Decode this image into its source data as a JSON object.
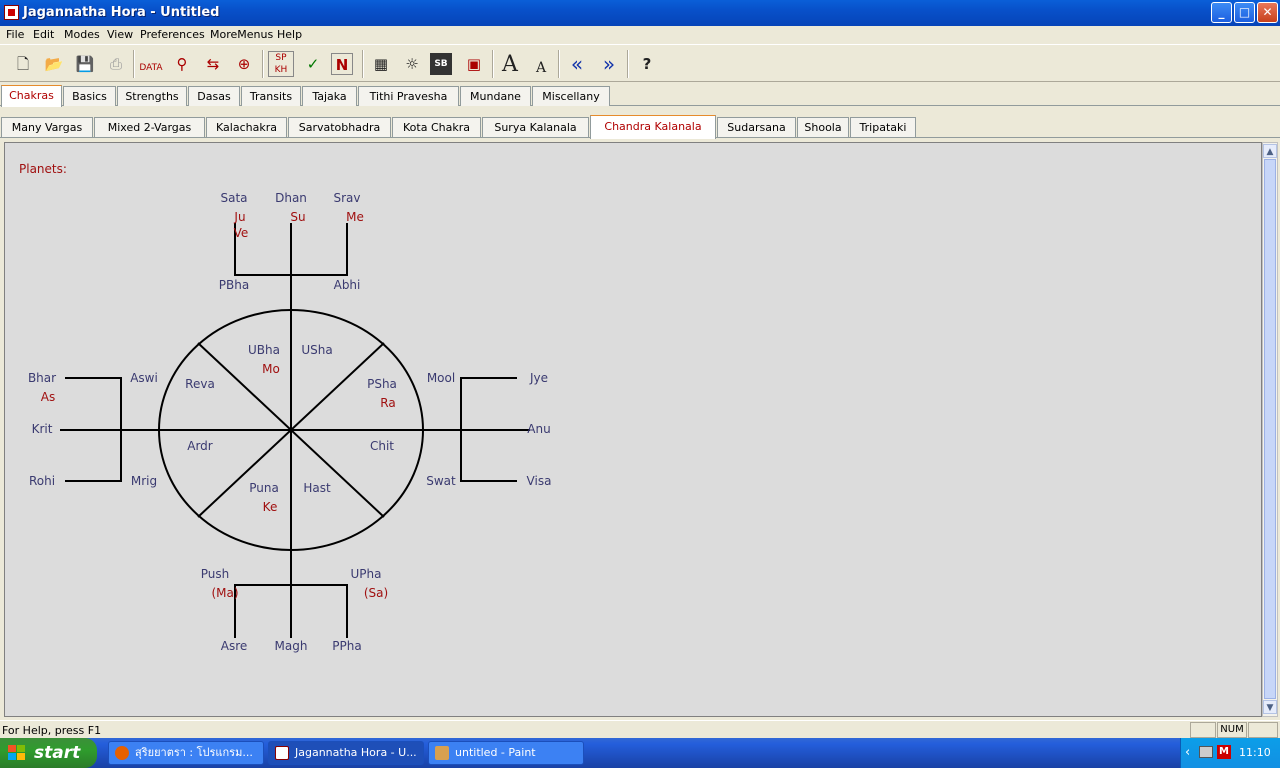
{
  "window": {
    "title": "Jagannatha Hora - Untitled"
  },
  "menu": [
    "File",
    "Edit",
    "Modes",
    "View",
    "Preferences",
    "MoreMenus",
    "Help"
  ],
  "toolbar": {
    "font_large": "A",
    "font_small": "A",
    "help": "?",
    "sp_kh": "SP KH",
    "n_btn": "N",
    "sb_btn": "SB"
  },
  "tabs_main": [
    "Chakras",
    "Basics",
    "Strengths",
    "Dasas",
    "Transits",
    "Tajaka",
    "Tithi Pravesha",
    "Mundane",
    "Miscellany"
  ],
  "tabs_sub": [
    "Many Vargas",
    "Mixed 2-Vargas",
    "Kalachakra",
    "Sarvatobhadra",
    "Kota Chakra",
    "Surya Kalanala",
    "Chandra Kalanala",
    "Sudarsana",
    "Shoola",
    "Tripataki"
  ],
  "chakra": {
    "heading": "Planets:",
    "nakshatras": {
      "sata": "Sata",
      "dhan": "Dhan",
      "srav": "Srav",
      "pbha": "PBha",
      "abhi": "Abhi",
      "bhar": "Bhar",
      "aswi": "Aswi",
      "krit": "Krit",
      "rohi": "Rohi",
      "mrig": "Mrig",
      "mool": "Mool",
      "jye": "Jye",
      "anu": "Anu",
      "swat": "Swat",
      "visa": "Visa",
      "uabha": "UBha",
      "usha": "USha",
      "reva": "Reva",
      "psha": "PSha",
      "ardr": "Ardr",
      "chit": "Chit",
      "puna": "Puna",
      "hast": "Hast",
      "push": "Push",
      "upha": "UPha",
      "asre": "Asre",
      "magh": "Magh",
      "ppha": "PPha"
    },
    "planets": {
      "ju": "Ju",
      "ve": "Ve",
      "su": "Su",
      "me": "Me",
      "as": "As",
      "mo": "Mo",
      "ra": "Ra",
      "ke": "Ke",
      "ma": "(Ma)",
      "sa": "(Sa)"
    }
  },
  "status": {
    "help": "For Help, press F1",
    "num": "NUM"
  },
  "taskbar": {
    "start": "start",
    "tasks": [
      "สุริยยาตรา : โปรแกรม...",
      "Jagannatha Hora - U...",
      "untitled - Paint"
    ],
    "clock": "11:10"
  },
  "colors": {
    "planet": "#a01010",
    "nakshatra": "#3a3a70",
    "title": "#0a4ed0"
  }
}
